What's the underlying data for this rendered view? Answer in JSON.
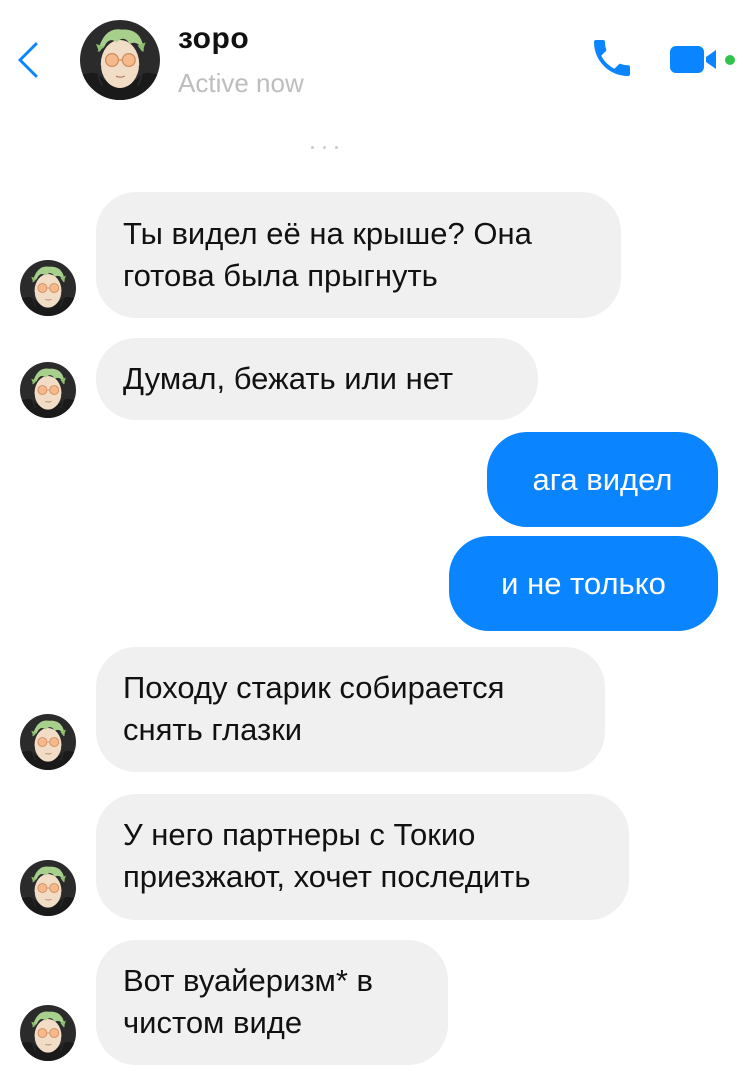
{
  "header": {
    "contact_name": "зоро",
    "status": "Active now",
    "accent_color": "#0a84ff",
    "icons": [
      "chevron-left-icon",
      "phone-icon",
      "video-camera-icon"
    ]
  },
  "messages": [
    {
      "direction": "incoming",
      "lines": [
        "Ты видел её на крыше? Она",
        "готова была прыгнуть"
      ]
    },
    {
      "direction": "incoming",
      "lines": [
        "Думал, бежать или нет"
      ]
    },
    {
      "direction": "outgoing",
      "lines": [
        "ага видел"
      ]
    },
    {
      "direction": "outgoing",
      "lines": [
        "и не только"
      ]
    },
    {
      "direction": "incoming",
      "lines": [
        "Походу старик собирается",
        "снять глазки"
      ]
    },
    {
      "direction": "incoming",
      "lines": [
        "У него партнеры с Токио",
        "приезжают, хочет последить"
      ]
    },
    {
      "direction": "incoming",
      "lines": [
        "Вот вуайеризм* в",
        "чистом виде"
      ]
    }
  ]
}
